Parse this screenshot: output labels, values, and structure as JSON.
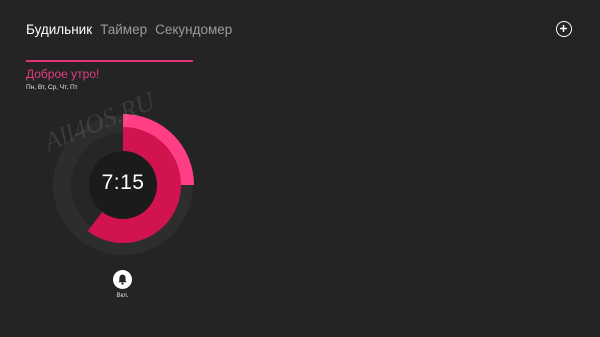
{
  "tabs": [
    {
      "label": "Будильник",
      "active": true
    },
    {
      "label": "Таймер",
      "active": false
    },
    {
      "label": "Секундомер",
      "active": false
    }
  ],
  "add_button_icon": "plus-circle-icon",
  "alarm": {
    "title": "Доброе утро!",
    "days": "Пн, Вт, Ср, Чт, Пт",
    "time": "7:15",
    "hour": 7,
    "minute": 15,
    "toggle_label": "Вкл.",
    "toggle_icon": "bell-icon"
  },
  "watermark": "All4OS.RU",
  "colors": {
    "background": "#242424",
    "accent": "#e0337a",
    "hour_arc": "#d1134f",
    "minute_arc": "#ff3e86",
    "ring_track": "#2f2f2f",
    "face": "#1c1c1c"
  }
}
